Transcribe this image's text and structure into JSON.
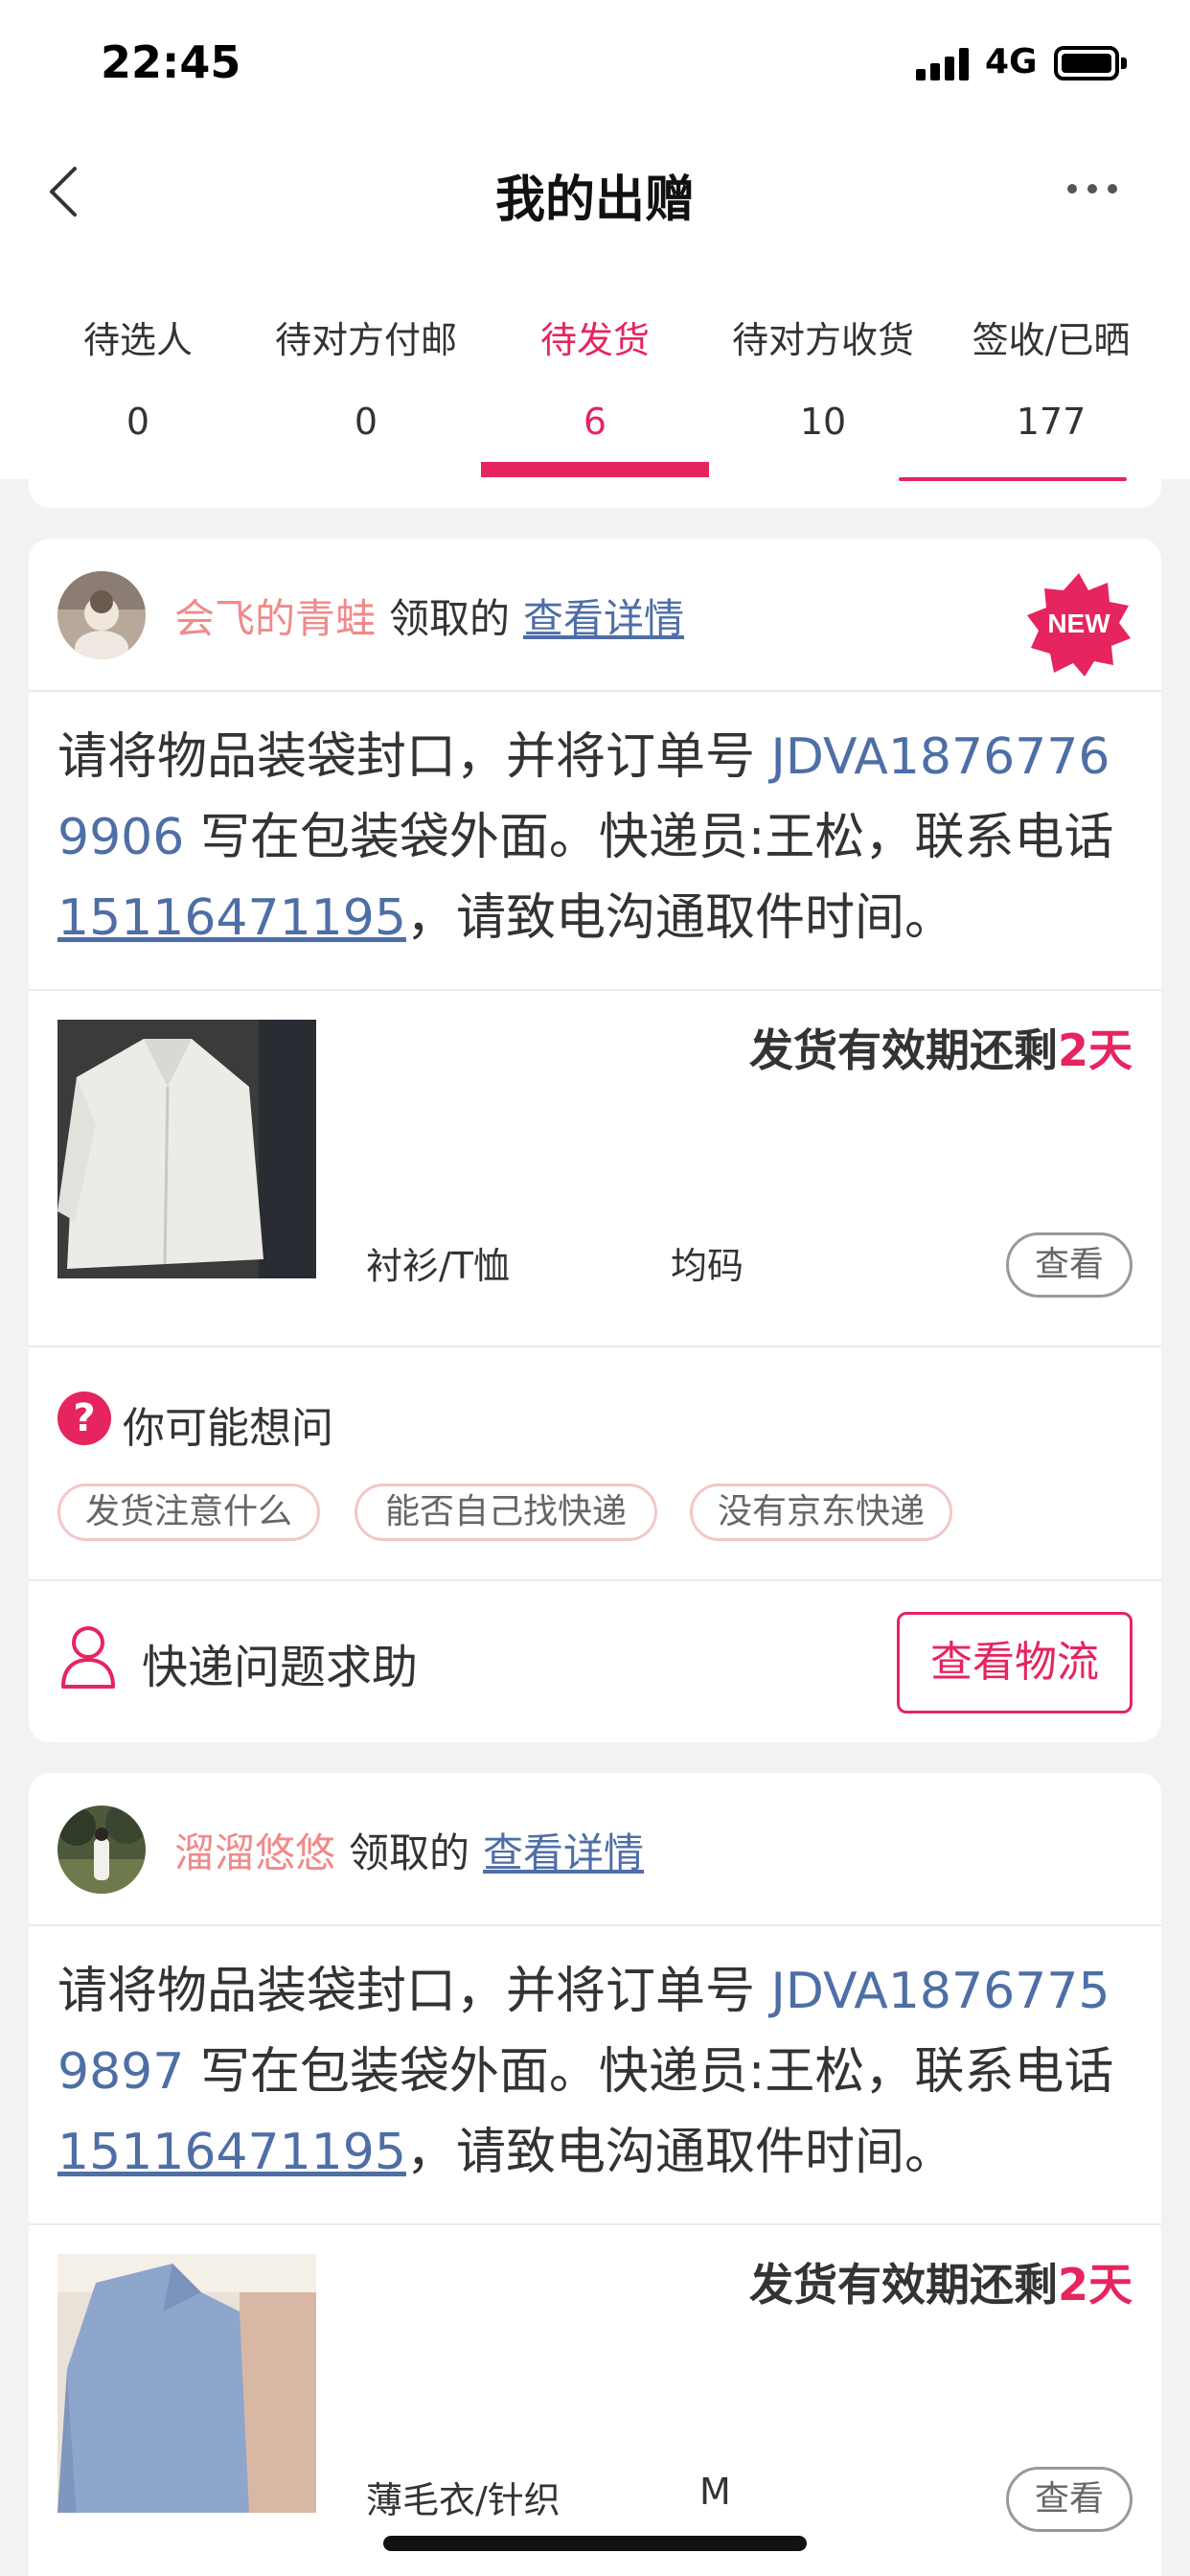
{
  "status_bar": {
    "time": "22:45",
    "network": "4G"
  },
  "nav": {
    "title": "我的出赠"
  },
  "tabs": [
    {
      "label": "待选人",
      "count": "0"
    },
    {
      "label": "待对方付邮",
      "count": "0"
    },
    {
      "label": "待发货",
      "count": "6",
      "active": true
    },
    {
      "label": "待对方收货",
      "count": "10"
    },
    {
      "label": "签收/已晒",
      "count": "177"
    }
  ],
  "cards": [
    {
      "user_name": "会飞的青蛙",
      "claim_text": "领取的",
      "detail_link": "查看详情",
      "badge": "NEW",
      "instruction_prefix": "请将物品装袋封口，并将订单号 ",
      "order_no": "JDVA18767769906",
      "instruction_mid": " 写在包装袋外面。快递员:王松，联系电话",
      "phone": "15116471195",
      "instruction_suffix": "，请致电沟通取件时间。",
      "deadline_prefix": "发货有效期还剩",
      "deadline_days": "2天",
      "category": "衬衫/T恤",
      "size": "均码",
      "view_label": "查看",
      "faq_title": "你可能想问",
      "faq_chips": [
        "发货注意什么",
        "能否自己找快递",
        "没有京东快递"
      ],
      "help_text": "快递问题求助",
      "logistics_label": "查看物流"
    },
    {
      "user_name": "溜溜悠悠",
      "claim_text": "领取的",
      "detail_link": "查看详情",
      "instruction_prefix": "请将物品装袋封口，并将订单号 ",
      "order_no": "JDVA18767759897",
      "instruction_mid": " 写在包装袋外面。快递员:王松，联系电话",
      "phone": "15116471195",
      "instruction_suffix": "，请致电沟通取件时间。",
      "deadline_prefix": "发货有效期还剩",
      "deadline_days": "2天",
      "category": "薄毛衣/针织",
      "size": "M",
      "view_label": "查看"
    }
  ],
  "colors": {
    "accent": "#e6245e",
    "link": "#4e6ea6",
    "username": "#f08a8a"
  },
  "icons": [
    "back-icon",
    "more-icon",
    "question-icon",
    "user-icon",
    "new-badge-icon"
  ]
}
